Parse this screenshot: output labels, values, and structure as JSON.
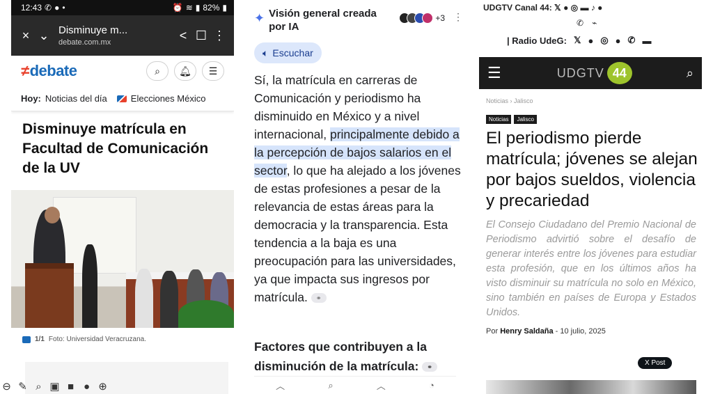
{
  "panel1": {
    "status": {
      "time": "12:43",
      "battery": "82%"
    },
    "browser": {
      "close_icon": "×",
      "tab_title": "Disminuye m...",
      "url": "debate.com.mx"
    },
    "site": {
      "logo_mark": "≠",
      "logo_word": "debate"
    },
    "nav": {
      "today_label": "Hoy:",
      "item1": "Noticias del día",
      "item2": "Elecciones México"
    },
    "headline": "Disminuye matrícula en Facultad de Comunicación de la UV",
    "caption": {
      "counter": "1/1",
      "credit": "Foto: Universidad Veracruzana."
    }
  },
  "panel2": {
    "header_title": "Visión general creada por IA",
    "avatars_more": "+3",
    "listen_label": "Escuchar",
    "body_part1": "Sí, la matrícula en carreras de Comunicación y periodismo ha disminuido en México y a nivel internacional, ",
    "body_highlight": "principalmente debido a la percepción de bajos salarios en el sector",
    "body_part2": ", lo que ha alejado a los jóvenes de estas profesiones a pesar de la relevancia de estas áreas para la democracia y la transparencia. Esta tendencia a la baja es una preocupación para las universidades, ya que impacta sus ingresos por matrícula.",
    "subheading": "Factores que contribuyen a la disminución de la matrícula:"
  },
  "panel3": {
    "social_top": "UDGTV Canal 44:",
    "radio_label": "| Radio UdeG:",
    "brand_text": "UDGTV",
    "brand_number": "44",
    "breadcrumb": "Noticias › Jalisco",
    "tag1": "Noticias",
    "tag2": "Jalisco",
    "headline": "El periodismo pierde matrícula; jóvenes se alejan por bajos sueldos, violencia y precariedad",
    "lead": "El Consejo Ciudadano del Premio Nacional de Periodismo advirtió sobre el desafío de generar interés entre los jóvenes para estudiar esta profesión, que en los últimos años ha visto disminuir su matrícula no solo en México, sino también en países de Europa y Estados Unidos.",
    "byline_prefix": "Por",
    "author": "Henry Saldaña",
    "date": "- 10 julio, 2025",
    "xpost_label": "X Post"
  },
  "colors": {
    "debate_blue": "#1a6ab8",
    "debate_red": "#e8412c",
    "ai_highlight": "#d6e4fb",
    "udg_green": "#9ec42c",
    "udg_bar": "#1c1c1c"
  }
}
